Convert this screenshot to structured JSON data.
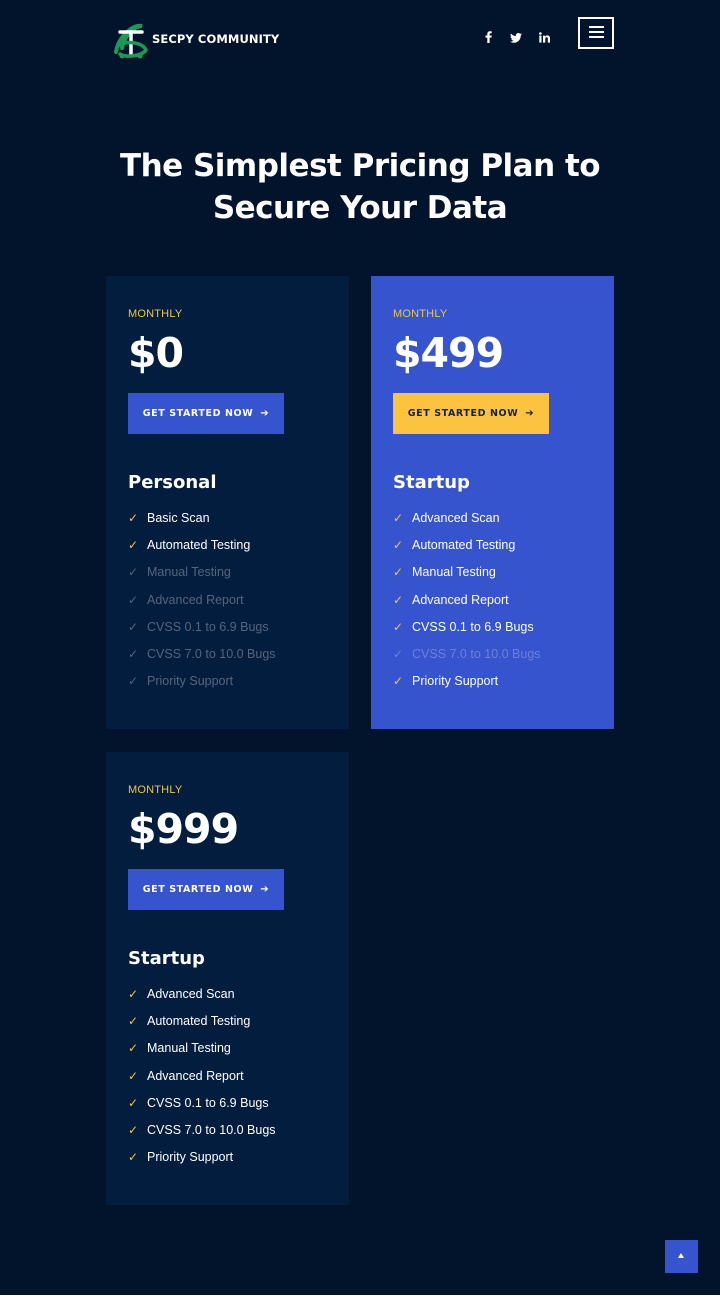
{
  "header": {
    "brand": "SECPY COMMUNITY",
    "socials": [
      {
        "icon": "facebook-icon",
        "glyph": "f"
      },
      {
        "icon": "twitter-icon",
        "glyph": "♥"
      },
      {
        "icon": "linkedin-icon",
        "glyph": "in"
      }
    ],
    "menu_icon": "hamburger-menu-icon"
  },
  "page": {
    "title_line1": "The Simplest Pricing Plan to",
    "title_line2": "Secure Your Data"
  },
  "colors": {
    "background": "#01142b",
    "card": "#031d3e",
    "accent_blue": "#3654ce",
    "accent_yellow": "#fbc33f"
  },
  "plans": [
    {
      "period": "MONTHLY",
      "price": "$0",
      "cta": "GET STARTED NOW",
      "name": "Personal",
      "features": [
        {
          "label": "Basic Scan",
          "included": true
        },
        {
          "label": "Automated Testing",
          "included": true
        },
        {
          "label": "Manual Testing",
          "included": false
        },
        {
          "label": "Advanced Report",
          "included": false
        },
        {
          "label": "CVSS 0.1 to 6.9 Bugs",
          "included": false
        },
        {
          "label": "CVSS 7.0 to 10.0 Bugs",
          "included": false
        },
        {
          "label": "Priority Support",
          "included": false
        }
      ]
    },
    {
      "period": "MONTHLY",
      "price": "$499",
      "cta": "GET STARTED NOW",
      "name": "Startup",
      "features": [
        {
          "label": "Advanced Scan",
          "included": true
        },
        {
          "label": "Automated Testing",
          "included": true
        },
        {
          "label": "Manual Testing",
          "included": true
        },
        {
          "label": "Advanced Report",
          "included": true
        },
        {
          "label": "CVSS 0.1 to 6.9 Bugs",
          "included": true
        },
        {
          "label": "CVSS 7.0 to 10.0 Bugs",
          "included": false
        },
        {
          "label": "Priority Support",
          "included": true
        }
      ]
    },
    {
      "period": "MONTHLY",
      "price": "$999",
      "cta": "GET STARTED NOW",
      "name": "Startup",
      "features": [
        {
          "label": "Advanced Scan",
          "included": true
        },
        {
          "label": "Automated Testing",
          "included": true
        },
        {
          "label": "Manual Testing",
          "included": true
        },
        {
          "label": "Advanced Report",
          "included": true
        },
        {
          "label": "CVSS 0.1 to 6.9 Bugs",
          "included": true
        },
        {
          "label": "CVSS 7.0 to 10.0 Bugs",
          "included": true
        },
        {
          "label": "Priority Support",
          "included": true
        }
      ]
    }
  ],
  "back_to_top_icon": "chevron-up-icon"
}
